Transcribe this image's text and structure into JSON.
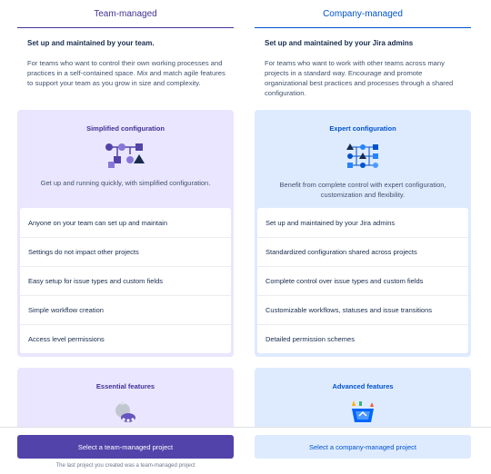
{
  "team": {
    "heading": "Team-managed",
    "subtitle": "Set up and maintained by your team.",
    "description": "For teams who want to control their own working processes and practices in a self-contained space. Mix and match agile features to support your team as you grow in size and complexity.",
    "config_title": "Simplified configuration",
    "config_desc": "Get up and running quickly, with simplified configuration.",
    "items": [
      "Anyone on your team can set up and maintain",
      "Settings do not impact other projects",
      "Easy setup for issue types and custom fields",
      "Simple workflow creation",
      "Access level permissions"
    ],
    "features_title": "Essential features"
  },
  "company": {
    "heading": "Company-managed",
    "subtitle": "Set up and maintained by your Jira admins",
    "description": "For teams who want to work with other teams across many projects in a standard way. Encourage and promote organizational best practices and processes through a shared configuration.",
    "config_title": "Expert configuration",
    "config_desc": "Benefit from complete control with expert configuration, customization and flexibility.",
    "items": [
      "Set up and maintained by your Jira admins",
      "Standardized configuration shared across projects",
      "Complete control over issue types and custom fields",
      "Customizable workflows, statuses and issue transitions",
      "Detailed permission schemes"
    ],
    "features_title": "Advanced features"
  },
  "footer": {
    "team_button": "Select a team-managed project",
    "company_button": "Select a company-managed project",
    "note": "The last project you created was a team-managed project"
  },
  "colors": {
    "team_accent": "#403294",
    "company_accent": "#0052cc",
    "team_button_bg": "#5243aa"
  }
}
